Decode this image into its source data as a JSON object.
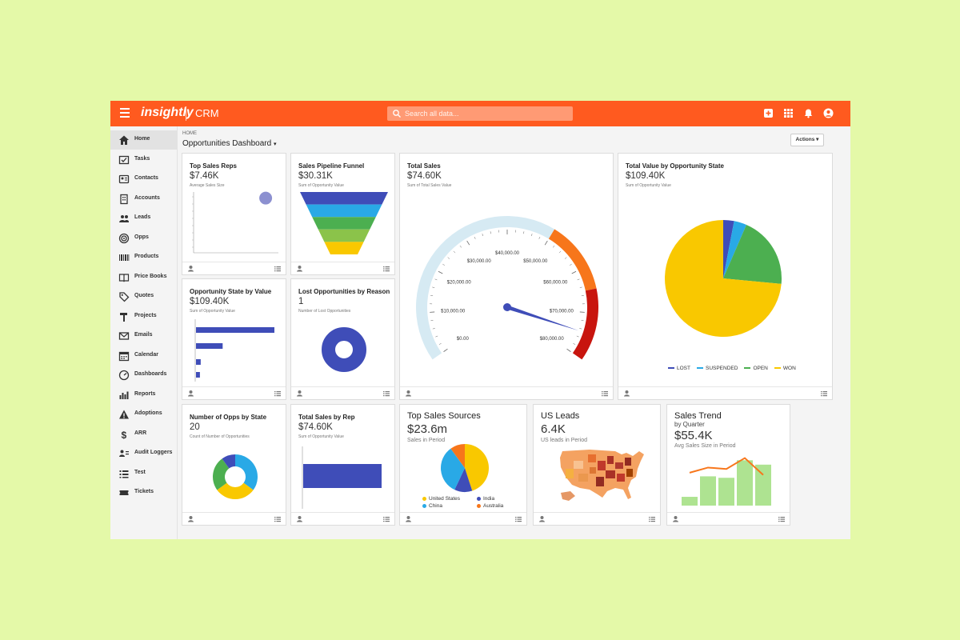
{
  "topbar": {
    "logo": "insightly",
    "app_name": "CRM",
    "search_placeholder": "Search all data..."
  },
  "sidebar": {
    "items": [
      {
        "label": "Home",
        "icon": "home-icon"
      },
      {
        "label": "Tasks",
        "icon": "tasks-icon"
      },
      {
        "label": "Contacts",
        "icon": "contacts-icon"
      },
      {
        "label": "Accounts",
        "icon": "accounts-icon"
      },
      {
        "label": "Leads",
        "icon": "leads-icon"
      },
      {
        "label": "Opps",
        "icon": "opps-icon"
      },
      {
        "label": "Products",
        "icon": "barcode-icon"
      },
      {
        "label": "Price Books",
        "icon": "book-icon"
      },
      {
        "label": "Quotes",
        "icon": "tag-icon"
      },
      {
        "label": "Projects",
        "icon": "hammer-icon"
      },
      {
        "label": "Emails",
        "icon": "envelope-icon"
      },
      {
        "label": "Calendar",
        "icon": "calendar-icon"
      },
      {
        "label": "Dashboards",
        "icon": "gauge-icon"
      },
      {
        "label": "Reports",
        "icon": "bar-chart-icon"
      },
      {
        "label": "Adoptions",
        "icon": "warning-icon"
      },
      {
        "label": "ARR",
        "icon": "dollar-icon"
      },
      {
        "label": "Audit Loggers",
        "icon": "user-list-icon"
      },
      {
        "label": "Test",
        "icon": "list-icon"
      },
      {
        "label": "Tickets",
        "icon": "ticket-icon"
      }
    ]
  },
  "header": {
    "breadcrumb": "HOME",
    "title": "Opportunities Dashboard",
    "actions_label": "Actions"
  },
  "cards": {
    "top_sales_reps": {
      "title": "Top Sales Reps",
      "value": "$7.46K",
      "subtitle": "Average Sales Size"
    },
    "pipeline_funnel": {
      "title": "Sales Pipeline Funnel",
      "value": "$30.31K",
      "subtitle": "Sum of Opportunity Value"
    },
    "total_sales": {
      "title": "Total Sales",
      "value": "$74.60K",
      "subtitle": "Sum of Total Sales Value"
    },
    "total_value_state": {
      "title": "Total Value by Opportunity State",
      "value": "$109.40K",
      "subtitle": "Sum of Opportunity Value"
    },
    "opp_state_value": {
      "title": "Opportunity State by Value",
      "value": "$109.40K",
      "subtitle": "Sum of Opportunity Value"
    },
    "lost_opps": {
      "title": "Lost Opportunities by Reason",
      "value": "1",
      "subtitle": "Number of Lost Opportunities"
    },
    "num_opps_state": {
      "title": "Number of Opps by State",
      "value": "20",
      "subtitle": "Count of Number of Opportunities"
    },
    "total_sales_rep": {
      "title": "Total Sales by Rep",
      "value": "$74.60K",
      "subtitle": "Sum of Opportunity Value"
    },
    "top_sources": {
      "title": "Top Sales Sources",
      "value": "$23.6m",
      "subtitle": "Sales in Period"
    },
    "us_leads": {
      "title": "US Leads",
      "value": "6.4K",
      "subtitle": "US leads in Period"
    },
    "sales_trend": {
      "title": "Sales Trend",
      "subtitle2": "by Quarter",
      "value": "$55.4K",
      "subtitle": "Avg Sales Size in Period"
    }
  },
  "colors": {
    "brand": "#ff5a1f",
    "indigo": "#3f4db8",
    "blue": "#29a9e6",
    "green": "#4caf50",
    "yellow": "#f9c800",
    "orange": "#f7761b",
    "red": "#c8150e",
    "light_green": "#aee391"
  },
  "chart_data": [
    {
      "type": "gauge",
      "id": "total_sales_gauge",
      "tick_labels": [
        "$0.00",
        "$10,000.00",
        "$20,000.00",
        "$30,000.00",
        "$40,000.00",
        "$50,000.00",
        "$60,000.00",
        "$70,000.00",
        "$80,000.00"
      ],
      "min": 0,
      "max": 80000,
      "value": 74600,
      "bands": [
        {
          "from": 0,
          "to": 50000,
          "color": "#d6eaf3"
        },
        {
          "from": 50000,
          "to": 65000,
          "color": "#f7761b"
        },
        {
          "from": 65000,
          "to": 80000,
          "color": "#c8150e"
        }
      ]
    },
    {
      "type": "pie",
      "id": "total_value_state_pie",
      "legend": [
        "LOST",
        "SUSPENDED",
        "OPEN",
        "WON"
      ],
      "values": [
        3,
        3.5,
        20,
        73.5
      ],
      "colors": [
        "#3f4db8",
        "#29a9e6",
        "#4caf50",
        "#f9c800"
      ]
    },
    {
      "type": "bar",
      "id": "opp_state_value_bars",
      "orientation": "horizontal",
      "values": [
        100,
        34,
        6,
        5
      ],
      "color": "#3f4db8"
    },
    {
      "type": "funnel",
      "id": "pipeline_funnel_chart",
      "values": [
        100,
        80,
        58,
        38,
        22
      ],
      "colors": [
        "#3f4db8",
        "#29a9e6",
        "#4caf50",
        "#8bc34a",
        "#f9c800"
      ]
    },
    {
      "type": "pie",
      "id": "num_opps_state_donut",
      "values": [
        35,
        30,
        25,
        10
      ],
      "colors": [
        "#29a9e6",
        "#f9c800",
        "#4caf50",
        "#3f4db8"
      ]
    },
    {
      "type": "bar",
      "id": "total_sales_rep_bars",
      "orientation": "horizontal",
      "values": [
        100
      ],
      "color": "#3f4db8"
    },
    {
      "type": "pie",
      "id": "top_sources_pie",
      "legend": [
        "United States",
        "India",
        "China",
        "Australia"
      ],
      "values": [
        45,
        12,
        33,
        10
      ],
      "colors": [
        "#f9c800",
        "#3f4db8",
        "#29a9e6",
        "#f7761b"
      ]
    },
    {
      "type": "bar",
      "id": "sales_trend_bars",
      "values": [
        12,
        40,
        38,
        62,
        56
      ],
      "line": [
        45,
        52,
        50,
        65,
        42
      ],
      "color": "#aee391",
      "line_color": "#f7761b"
    },
    {
      "type": "pie",
      "id": "lost_opps_donut",
      "values": [
        1
      ],
      "colors": [
        "#3f4db8"
      ]
    },
    {
      "type": "scatter",
      "id": "top_sales_reps_scatter",
      "points": [
        {
          "x": 0.85,
          "y": 0.9
        }
      ],
      "color": "#8c90d0"
    }
  ]
}
